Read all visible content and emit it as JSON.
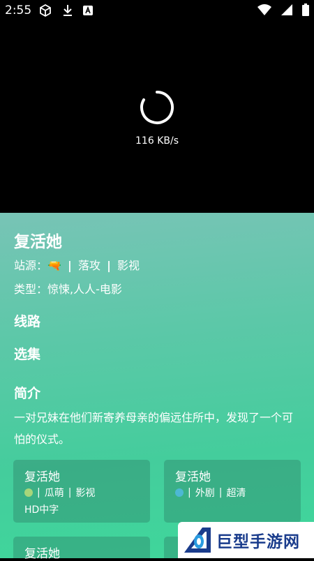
{
  "status_bar": {
    "time": "2:55"
  },
  "player": {
    "speed": "116 KB/s"
  },
  "details": {
    "title": "复活她",
    "source_label": "站源：",
    "source_emoji": "🔫",
    "source_sep1": "|",
    "source_name": "落攻",
    "source_sep2": "|",
    "source_category": "影视",
    "type_label": "类型：",
    "type_value": "惊悚,人人-电影",
    "route_heading": "线路",
    "episodes_heading": "选集",
    "intro_heading": "简介",
    "intro_text": "一对兄妹在他们新寄养母亲的偏远住所中，发现了一个可怕的仪式。"
  },
  "cards": [
    {
      "title": "复活她",
      "site": "瓜萌",
      "category": "影视",
      "quality": "HD中字",
      "sep": "|"
    },
    {
      "title": "复活她",
      "site": "外剧",
      "category": "超清",
      "quality": "",
      "sep": "|"
    },
    {
      "title": "复活她"
    }
  ],
  "watermark": {
    "text": "巨型手游网"
  },
  "colors": {
    "panel_top": "#78c4b6",
    "panel_bottom": "#3fd79b",
    "watermark_blue": "#1a3c8c"
  }
}
